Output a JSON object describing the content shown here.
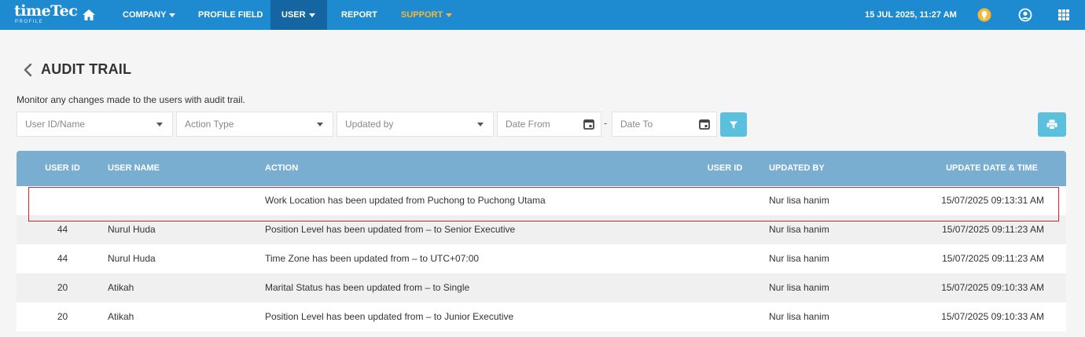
{
  "nav": {
    "logo_text": "timeTec",
    "logo_sub": "PROFILE",
    "items": [
      {
        "label": "COMPANY"
      },
      {
        "label": "PROFILE FIELD"
      },
      {
        "label": "USER"
      },
      {
        "label": "REPORT"
      },
      {
        "label": "SUPPORT"
      }
    ],
    "datetime": "15 JUL 2025, 11:27 AM",
    "colors": {
      "bar": "#1e8bd0",
      "active": "#1565a2",
      "support": "#f5b836"
    }
  },
  "header": {
    "title": "AUDIT TRAIL",
    "description": "Monitor any changes made to the users with audit trail."
  },
  "filters": {
    "user": "User ID/Name",
    "action_type": "Action Type",
    "updated_by": "Updated by",
    "date_from": "Date From",
    "date_to": "Date To",
    "separator": "-"
  },
  "table": {
    "headers": {
      "user_id": "USER ID",
      "user_name": "USER NAME",
      "action": "ACTION",
      "user_id2": "USER ID",
      "updated_by": "UPDATED BY",
      "datetime": "UPDATE DATE & TIME"
    },
    "rows": [
      {
        "user_id": "",
        "user_name": "",
        "action": "Work Location has been updated from Puchong to Puchong Utama",
        "user_id2": "",
        "updated_by": "Nur lisa hanim",
        "datetime": "15/07/2025 09:13:31 AM"
      },
      {
        "user_id": "44",
        "user_name": "Nurul Huda",
        "action": "Position Level has been updated from – to Senior Executive",
        "user_id2": "",
        "updated_by": "Nur lisa hanim",
        "datetime": "15/07/2025 09:11:23 AM"
      },
      {
        "user_id": "44",
        "user_name": "Nurul Huda",
        "action": "Time Zone has been updated from – to UTC+07:00",
        "user_id2": "",
        "updated_by": "Nur lisa hanim",
        "datetime": "15/07/2025 09:11:23 AM"
      },
      {
        "user_id": "20",
        "user_name": "Atikah",
        "action": "Marital Status has been updated from – to Single",
        "user_id2": "",
        "updated_by": "Nur lisa hanim",
        "datetime": "15/07/2025 09:10:33 AM"
      },
      {
        "user_id": "20",
        "user_name": "Atikah",
        "action": "Position Level has been updated from – to Junior Executive",
        "user_id2": "",
        "updated_by": "Nur lisa hanim",
        "datetime": "15/07/2025 09:10:33 AM"
      }
    ],
    "colors": {
      "header": "#7aaed1",
      "highlight": "#d9232d"
    }
  }
}
